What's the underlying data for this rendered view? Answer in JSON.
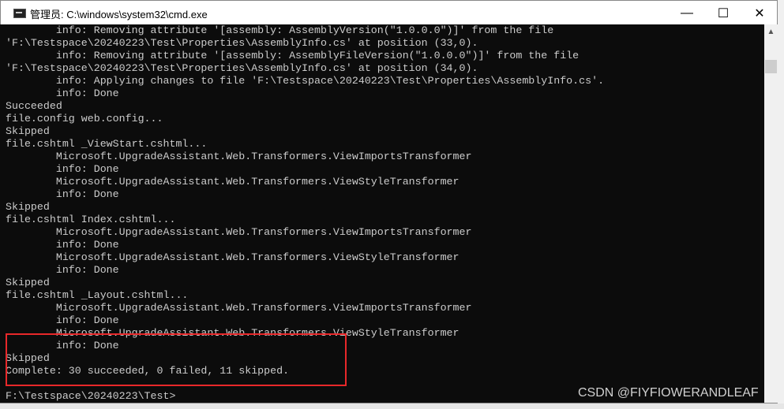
{
  "window": {
    "title": "管理员: C:\\windows\\system32\\cmd.exe",
    "minimize": "—",
    "maximize": "☐",
    "close": "✕"
  },
  "console": {
    "lines": [
      "        info: Removing attribute '[assembly: AssemblyVersion(\"1.0.0.0\")]' from the file",
      "'F:\\Testspace\\20240223\\Test\\Properties\\AssemblyInfo.cs' at position (33,0).",
      "        info: Removing attribute '[assembly: AssemblyFileVersion(\"1.0.0.0\")]' from the file",
      "'F:\\Testspace\\20240223\\Test\\Properties\\AssemblyInfo.cs' at position (34,0).",
      "        info: Applying changes to file 'F:\\Testspace\\20240223\\Test\\Properties\\AssemblyInfo.cs'.",
      "        info: Done",
      "Succeeded",
      "file.config web.config...",
      "Skipped",
      "file.cshtml _ViewStart.cshtml...",
      "        Microsoft.UpgradeAssistant.Web.Transformers.ViewImportsTransformer",
      "        info: Done",
      "        Microsoft.UpgradeAssistant.Web.Transformers.ViewStyleTransformer",
      "        info: Done",
      "Skipped",
      "file.cshtml Index.cshtml...",
      "        Microsoft.UpgradeAssistant.Web.Transformers.ViewImportsTransformer",
      "        info: Done",
      "        Microsoft.UpgradeAssistant.Web.Transformers.ViewStyleTransformer",
      "        info: Done",
      "Skipped",
      "file.cshtml _Layout.cshtml...",
      "        Microsoft.UpgradeAssistant.Web.Transformers.ViewImportsTransformer",
      "        info: Done",
      "        Microsoft.UpgradeAssistant.Web.Transformers.ViewStyleTransformer",
      "        info: Done",
      "Skipped",
      "Complete: 30 succeeded, 0 failed, 11 skipped.",
      "",
      "F:\\Testspace\\20240223\\Test>"
    ]
  },
  "watermark": "CSDN @FIYFIOWERANDLEAF",
  "colors": {
    "console_bg": "#0c0c0c",
    "console_text": "#cccccc",
    "highlight": "#e8282a"
  }
}
